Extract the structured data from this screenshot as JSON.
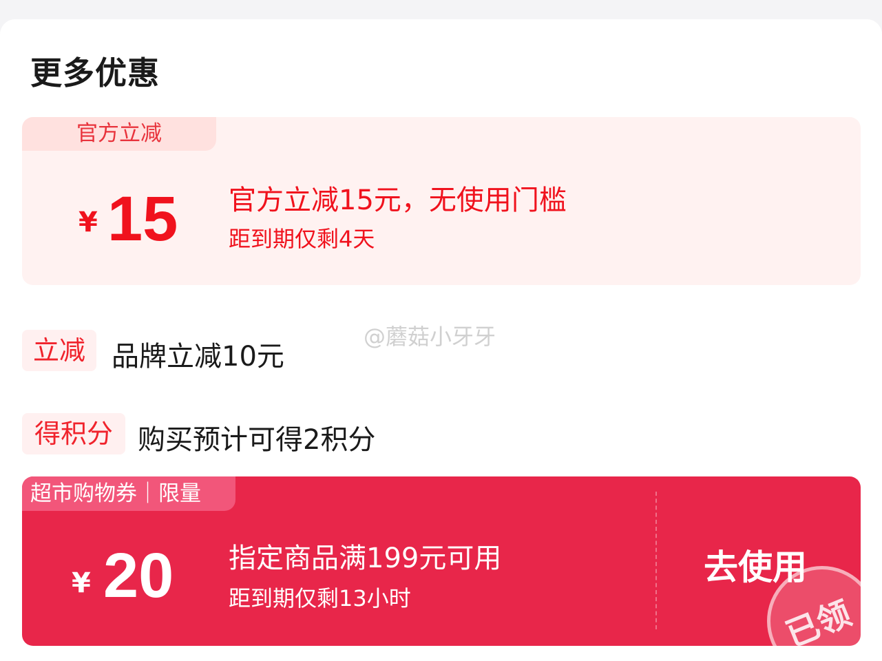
{
  "section_title": "更多优惠",
  "official_coupon": {
    "tag": "官方立减",
    "currency": "¥",
    "amount": "15",
    "description": "官方立减15元，无使用门槛",
    "expiry": "距到期仅剩4天"
  },
  "brand_discount": {
    "badge": "立减",
    "text": "品牌立减10元"
  },
  "points": {
    "badge": "得积分",
    "text": "购买预计可得2积分"
  },
  "watermark": "@蘑菇小牙牙",
  "supermarket_coupon": {
    "tag": "超市购物券｜限量",
    "currency": "¥",
    "amount": "20",
    "description": "指定商品满199元可用",
    "expiry": "距到期仅剩13小时",
    "action": "去使用",
    "stamp": "已领"
  },
  "colors": {
    "accent_red": "#f0121d",
    "coupon_red_bg": "#e8264a",
    "light_coupon_bg": "#fff2f1"
  }
}
